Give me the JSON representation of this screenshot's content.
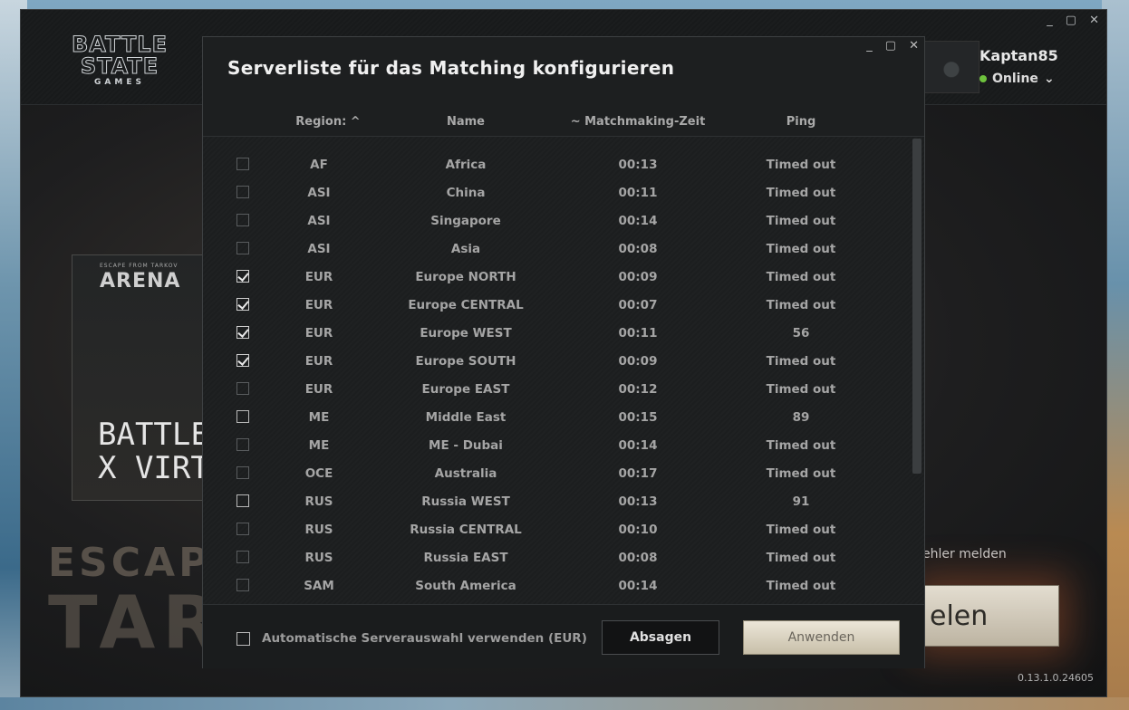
{
  "launcher": {
    "logo_line1": "BATTLE",
    "logo_line2": "STATE",
    "logo_line3": "GAMES",
    "window_controls": [
      "_",
      "▢",
      "✕"
    ],
    "user": {
      "name": "Kaptan85",
      "status": "Online",
      "status_color": "#6ec23d"
    },
    "arena_small": "ESCAPE FROM TARKOV",
    "arena_logo": "ARENA",
    "arena_line1": "BATTLEST",
    "arena_line2": "X VIRTUS",
    "tarkov_line1": "ESCAPE",
    "tarkov_line2": "TAR",
    "bug_report": "ehler melden",
    "play_label": "elen",
    "version": "0.13.1.0.24605"
  },
  "dialog": {
    "title": "Serverliste für das Matching konfigurieren",
    "window_controls": [
      "_",
      "▢",
      "✕"
    ],
    "columns": {
      "region": "Region: ^",
      "name": "Name",
      "time": "~ Matchmaking-Zeit",
      "ping": "Ping"
    },
    "rows": [
      {
        "checked": false,
        "region": "AF",
        "name": "Africa",
        "time": "00:13",
        "ping": "Timed out"
      },
      {
        "checked": false,
        "region": "ASI",
        "name": "China",
        "time": "00:11",
        "ping": "Timed out"
      },
      {
        "checked": false,
        "region": "ASI",
        "name": "Singapore",
        "time": "00:14",
        "ping": "Timed out"
      },
      {
        "checked": false,
        "region": "ASI",
        "name": "Asia",
        "time": "00:08",
        "ping": "Timed out"
      },
      {
        "checked": true,
        "region": "EUR",
        "name": "Europe NORTH",
        "time": "00:09",
        "ping": "Timed out"
      },
      {
        "checked": true,
        "region": "EUR",
        "name": "Europe CENTRAL",
        "time": "00:07",
        "ping": "Timed out"
      },
      {
        "checked": true,
        "region": "EUR",
        "name": "Europe WEST",
        "time": "00:11",
        "ping": "56"
      },
      {
        "checked": true,
        "region": "EUR",
        "name": "Europe SOUTH",
        "time": "00:09",
        "ping": "Timed out"
      },
      {
        "checked": false,
        "region": "EUR",
        "name": "Europe EAST",
        "time": "00:12",
        "ping": "Timed out"
      },
      {
        "checked": false,
        "region": "ME",
        "name": "Middle East",
        "time": "00:15",
        "ping": "89"
      },
      {
        "checked": false,
        "region": "ME",
        "name": "ME - Dubai",
        "time": "00:14",
        "ping": "Timed out"
      },
      {
        "checked": false,
        "region": "OCE",
        "name": "Australia",
        "time": "00:17",
        "ping": "Timed out"
      },
      {
        "checked": false,
        "region": "RUS",
        "name": "Russia WEST",
        "time": "00:13",
        "ping": "91"
      },
      {
        "checked": false,
        "region": "RUS",
        "name": "Russia CENTRAL",
        "time": "00:10",
        "ping": "Timed out"
      },
      {
        "checked": false,
        "region": "RUS",
        "name": "Russia EAST",
        "time": "00:08",
        "ping": "Timed out"
      },
      {
        "checked": false,
        "region": "SAM",
        "name": "South America",
        "time": "00:14",
        "ping": "Timed out"
      }
    ],
    "auto_select": {
      "checked": false,
      "label": "Automatische Serverauswahl verwenden (EUR)"
    },
    "cancel_label": "Absagen",
    "apply_label": "Anwenden"
  }
}
